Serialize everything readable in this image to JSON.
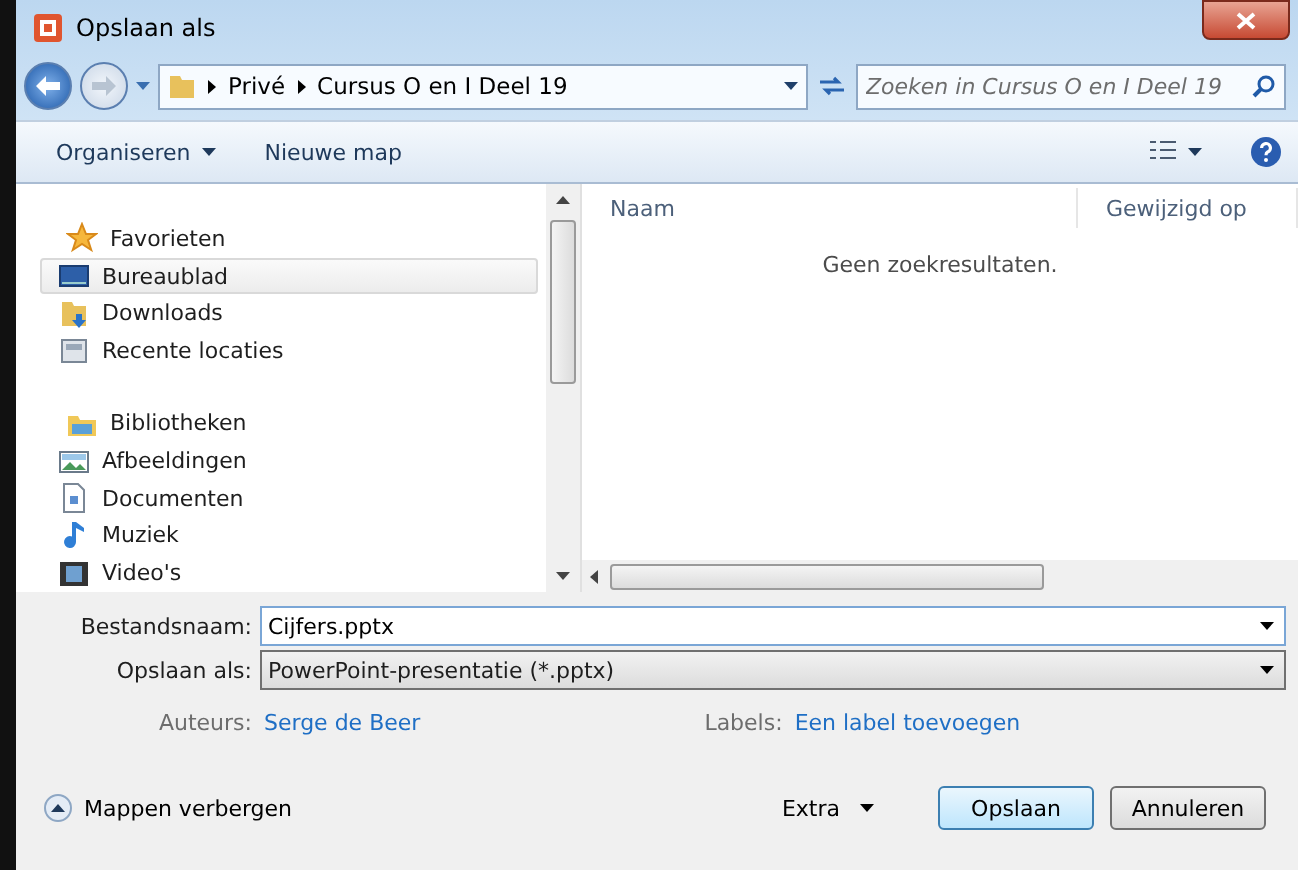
{
  "window": {
    "title": "Opslaan als"
  },
  "address": {
    "crumbs": [
      "Privé",
      "Cursus O en I Deel 19"
    ],
    "search_placeholder": "Zoeken in Cursus O en I Deel 19"
  },
  "toolbar": {
    "organize": "Organiseren",
    "new_folder": "Nieuwe map"
  },
  "navigation": [
    {
      "label": "Favorieten",
      "kind": "star",
      "selected": false,
      "children": [
        {
          "label": "Bureaublad",
          "kind": "desktop",
          "selected": true
        },
        {
          "label": "Downloads",
          "kind": "download",
          "selected": false
        },
        {
          "label": "Recente locaties",
          "kind": "recent",
          "selected": false
        }
      ]
    },
    {
      "label": "Bibliotheken",
      "kind": "library",
      "selected": false,
      "children": [
        {
          "label": "Afbeeldingen",
          "kind": "picture",
          "selected": false
        },
        {
          "label": "Documenten",
          "kind": "document",
          "selected": false
        },
        {
          "label": "Muziek",
          "kind": "music",
          "selected": false
        },
        {
          "label": "Video's",
          "kind": "video",
          "selected": false
        }
      ]
    }
  ],
  "file_list": {
    "columns": [
      "Naam",
      "Gewijzigd op"
    ],
    "empty_message": "Geen zoekresultaten."
  },
  "form": {
    "filename_label": "Bestandsnaam:",
    "filename": "Cijfers.pptx",
    "type_label": "Opslaan als:",
    "type": "PowerPoint-presentatie (*.pptx)",
    "authors_label": "Auteurs:",
    "authors": "Serge de Beer",
    "tags_label": "Labels:",
    "tags": "Een label toevoegen"
  },
  "footer": {
    "hide_folders": "Mappen verbergen",
    "extra": "Extra",
    "save": "Opslaan",
    "cancel": "Annuleren"
  }
}
